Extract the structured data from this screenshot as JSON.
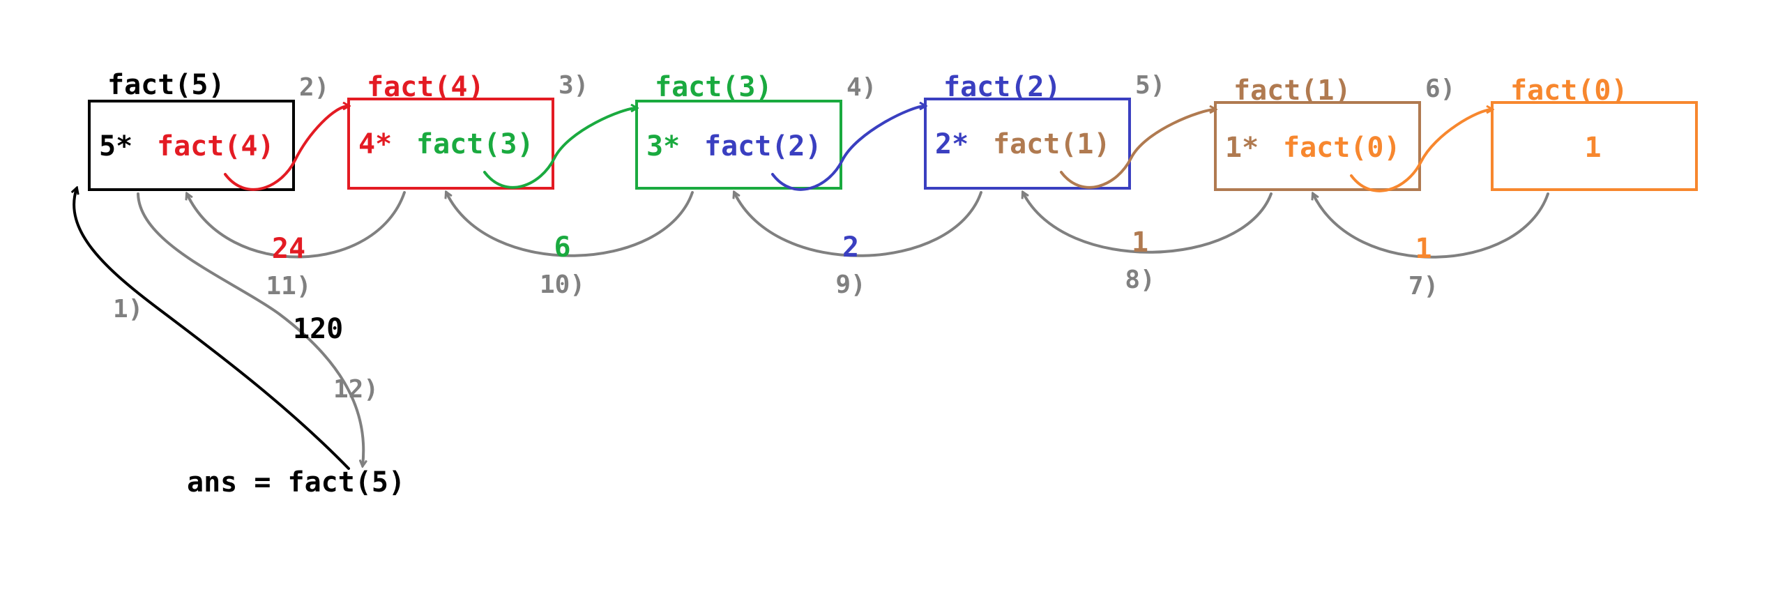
{
  "colors": {
    "black": "#000000",
    "red": "#e31b23",
    "green": "#1aaa3f",
    "blue": "#3a3fc0",
    "brown": "#b07a50",
    "orange": "#f7872e",
    "gray": "#808080"
  },
  "frames": [
    {
      "id": "fact5",
      "title": "fact(5)",
      "prefix": "5*",
      "call": "fact(4)",
      "color": "black",
      "call_color": "red"
    },
    {
      "id": "fact4",
      "title": "fact(4)",
      "prefix": "4*",
      "call": "fact(3)",
      "color": "red",
      "call_color": "green"
    },
    {
      "id": "fact3",
      "title": "fact(3)",
      "prefix": "3*",
      "call": "fact(2)",
      "color": "green",
      "call_color": "blue"
    },
    {
      "id": "fact2",
      "title": "fact(2)",
      "prefix": "2*",
      "call": "fact(1)",
      "color": "blue",
      "call_color": "brown"
    },
    {
      "id": "fact1",
      "title": "fact(1)",
      "prefix": "1*",
      "call": "fact(0)",
      "color": "brown",
      "call_color": "orange"
    },
    {
      "id": "fact0",
      "title": "fact(0)",
      "prefix": "",
      "call": "1",
      "color": "orange",
      "call_color": "orange"
    }
  ],
  "call_steps": [
    "2)",
    "3)",
    "4)",
    "5)",
    "6)"
  ],
  "returns": [
    {
      "value": "24",
      "step": "11)",
      "color": "red"
    },
    {
      "value": "6",
      "step": "10)",
      "color": "green"
    },
    {
      "value": "2",
      "step": "9)",
      "color": "blue"
    },
    {
      "value": "1",
      "step": "8)",
      "color": "brown"
    },
    {
      "value": "1",
      "step": "7)",
      "color": "orange"
    }
  ],
  "entry": {
    "statement": "ans = fact(5)",
    "call_step": "1)",
    "result": "120",
    "result_step": "12)"
  }
}
